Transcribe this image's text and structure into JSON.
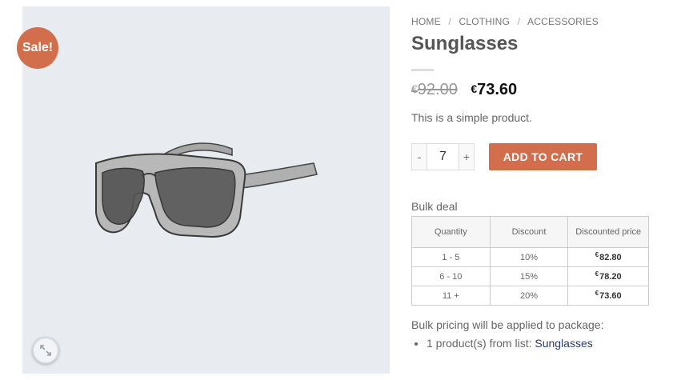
{
  "badge": {
    "sale_label": "Sale!"
  },
  "breadcrumb": {
    "items": [
      "HOME",
      "CLOTHING",
      "ACCESSORIES"
    ],
    "separator": "/"
  },
  "product": {
    "title": "Sunglasses",
    "currency_symbol": "€",
    "old_price": "92.00",
    "new_price": "73.60",
    "short_description": "This is a simple product.",
    "image_icon": "sunglasses-image"
  },
  "cart": {
    "minus_label": "-",
    "plus_label": "+",
    "quantity": "7",
    "add_to_cart_label": "ADD TO CART"
  },
  "bulk": {
    "title": "Bulk deal",
    "headers": [
      "Quantity",
      "Discount",
      "Discounted price"
    ],
    "rows": [
      {
        "quantity": "1 - 5",
        "discount": "10%",
        "price": "82.80"
      },
      {
        "quantity": "6 - 10",
        "discount": "15%",
        "price": "78.20"
      },
      {
        "quantity": "11 +",
        "discount": "20%",
        "price": "73.60"
      }
    ],
    "note": "Bulk pricing will be applied to package:",
    "item_prefix": "1 product(s) from list:",
    "item_link": "Sunglasses"
  },
  "colors": {
    "accent": "#d26e4b",
    "image_background": "#e8ecf1",
    "link": "#2a3b6e"
  }
}
